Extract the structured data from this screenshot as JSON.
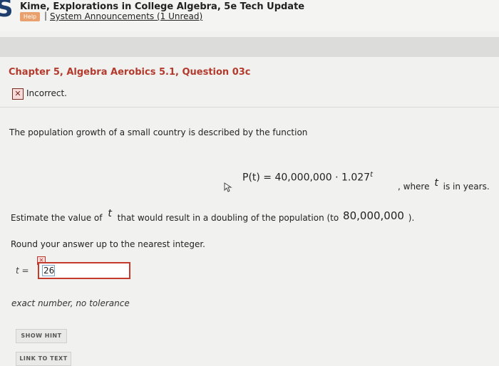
{
  "header": {
    "title": "Kime, Explorations in College Algebra, 5e Tech Update",
    "help_label": "Help",
    "separator": "|",
    "announcements_link": "System Announcements (1 Unread)"
  },
  "question": {
    "title": "Chapter 5, Algebra Aerobics 5.1, Question 03c",
    "status_icon": "x-icon",
    "status_text": "Incorrect.",
    "prompt": "The population growth of a small country is described by the function",
    "formula_lhs": "P(t) = 40,000,000 · 1.027",
    "formula_exp": "t",
    "where_prefix": ", where",
    "where_var": "t",
    "where_suffix": "is in years.",
    "estimate_prefix": "Estimate the value of",
    "estimate_var": "t",
    "estimate_middle": "that would result in a doubling of the population (to",
    "estimate_target": "80,000,000",
    "estimate_suffix": ").",
    "round_text": "Round your answer up to the nearest integer."
  },
  "answer": {
    "label": "t =",
    "value": "26",
    "tolerance": "exact number, no tolerance"
  },
  "buttons": {
    "show_hint": "SHOW HINT",
    "link_to_text": "LINK TO TEXT"
  },
  "colors": {
    "title_red": "#b33a2c",
    "error_border": "#c43a2c",
    "logo_blue": "#1e3f6e"
  }
}
